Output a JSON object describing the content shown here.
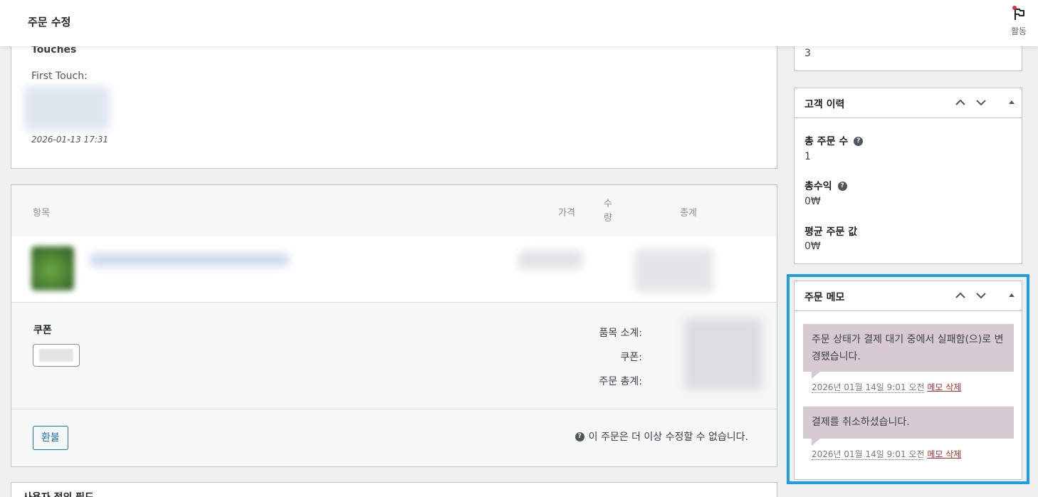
{
  "header": {
    "title": "주문 수정",
    "activity_label": "활동",
    "activity_icon": "flag-icon"
  },
  "touches": {
    "heading": "Touches",
    "first_touch_label": "First Touch:",
    "date": "2026-01-13 17:31"
  },
  "items": {
    "col_item": "항목",
    "col_price": "가격",
    "col_qty": "수량",
    "col_total": "총계",
    "coupon_heading": "쿠폰",
    "subtotal_label": "품목 소계:",
    "coupon_label": "쿠폰:",
    "order_total_label": "주문 총계:",
    "refund_button": "환불",
    "no_edit_text": "이 주문은 더 이상 수정할 수 없습니다."
  },
  "custom_fields": {
    "heading": "사용자 정의 필드"
  },
  "side_top": {
    "value": "3"
  },
  "customer_history": {
    "title": "고객 이력",
    "total_orders_label": "총 주문 수",
    "total_orders_value": "1",
    "total_revenue_label": "총수익",
    "total_revenue_value": "0₩",
    "avg_order_label": "평균 주문 값",
    "avg_order_value": "0₩"
  },
  "order_notes": {
    "title": "주문 메모",
    "notes": [
      {
        "text": "주문 상태가 결제 대기 중에서 실패함(으)로 변경됐습니다.",
        "timestamp": "2026년 01월 14일 9:01 오전",
        "delete_label": "메모 삭제"
      },
      {
        "text": "결제를 취소하셨습니다.",
        "timestamp": "2026년 01월 14일 9:01 오전",
        "delete_label": "메모 삭제"
      }
    ]
  },
  "colors": {
    "accent": "#2271b1",
    "highlight": "#1e9be9",
    "note_bg": "#d7cad2",
    "delete": "#b32d2e"
  }
}
